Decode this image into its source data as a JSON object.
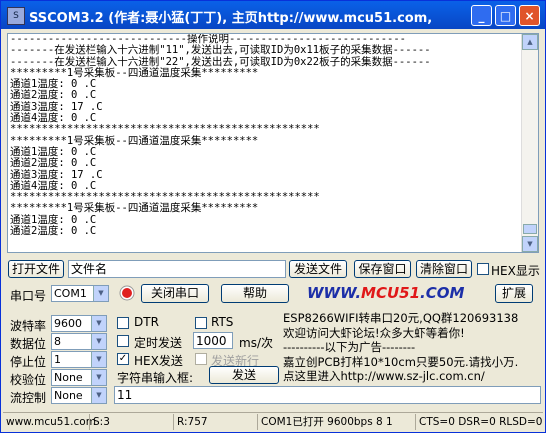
{
  "window": {
    "title": "SSCOM3.2 (作者:聂小猛(丁丁), 主页http://www.mcu51.com,",
    "minimize_glyph": "_",
    "maximize_glyph": "□",
    "close_glyph": "×"
  },
  "terminal": {
    "lines": [
      "----------------------------操作说明----------------------------",
      "-------在发送栏输入十六进制\"11\",发送出去,可读取ID为0x11板子的采集数据------",
      "-------在发送栏输入十六进制\"22\",发送出去,可读取ID为0x22板子的采集数据------",
      "*********1号采集板--四通道温度采集*********",
      "通道1温度: 0 .C",
      "通道2温度: 0 .C",
      "通道3温度: 17 .C",
      "通道4温度: 0 .C",
      "*************************************************",
      "*********1号采集板--四通道温度采集*********",
      "通道1温度: 0 .C",
      "通道2温度: 0 .C",
      "通道3温度: 17 .C",
      "通道4温度: 0 .C",
      "*************************************************",
      "*********1号采集板--四通道温度采集*********",
      "通道1温度: 0 .C",
      "通道2温度: 0 .C"
    ]
  },
  "toolbar1": {
    "open_file": "打开文件",
    "filename": "文件名",
    "send_file": "发送文件",
    "save_window": "保存窗口",
    "clear_window": "清除窗口",
    "hex_display": "HEX显示"
  },
  "toolbar2": {
    "port_label": "串口号",
    "port_value": "COM1",
    "close_port": "关闭串口",
    "help": "帮助",
    "logo": "WWW.MCU51.COM",
    "expand": "扩展"
  },
  "settings": {
    "baud_label": "波特率",
    "baud_value": "9600",
    "databits_label": "数据位",
    "databits_value": "8",
    "stopbits_label": "停止位",
    "stopbits_value": "1",
    "parity_label": "校验位",
    "parity_value": "None",
    "flow_label": "流控制",
    "flow_value": "None"
  },
  "controls": {
    "dtr": "DTR",
    "rts": "RTS",
    "timed_send": "定时发送",
    "interval": "1000",
    "interval_unit": "ms/次",
    "hex_send": "HEX发送",
    "send_newline": "发送新行",
    "input_label": "字符串输入框:",
    "send": "发送",
    "input_value": "11"
  },
  "ad": {
    "lines": [
      "ESP8266WIFI转串口20元,QQ群120693138",
      "欢迎访问大虾论坛!众多大虾等着你!",
      "----------以下为广告--------",
      "嘉立创PCB打样10*10cm只要50元.请找小万.",
      "点这里进入http://www.sz-jlc.com.cn/"
    ]
  },
  "statusbar": {
    "site": "www.mcu51.com",
    "s": "S:3",
    "r": "R:757",
    "port": "COM1已打开  9600bps  8 1",
    "signals": "CTS=0 DSR=0 RLSD=0"
  },
  "colors": {
    "title_blue": "#0a61e8",
    "logo_blue": "#1c2fa8",
    "logo_red": "#e01818"
  }
}
